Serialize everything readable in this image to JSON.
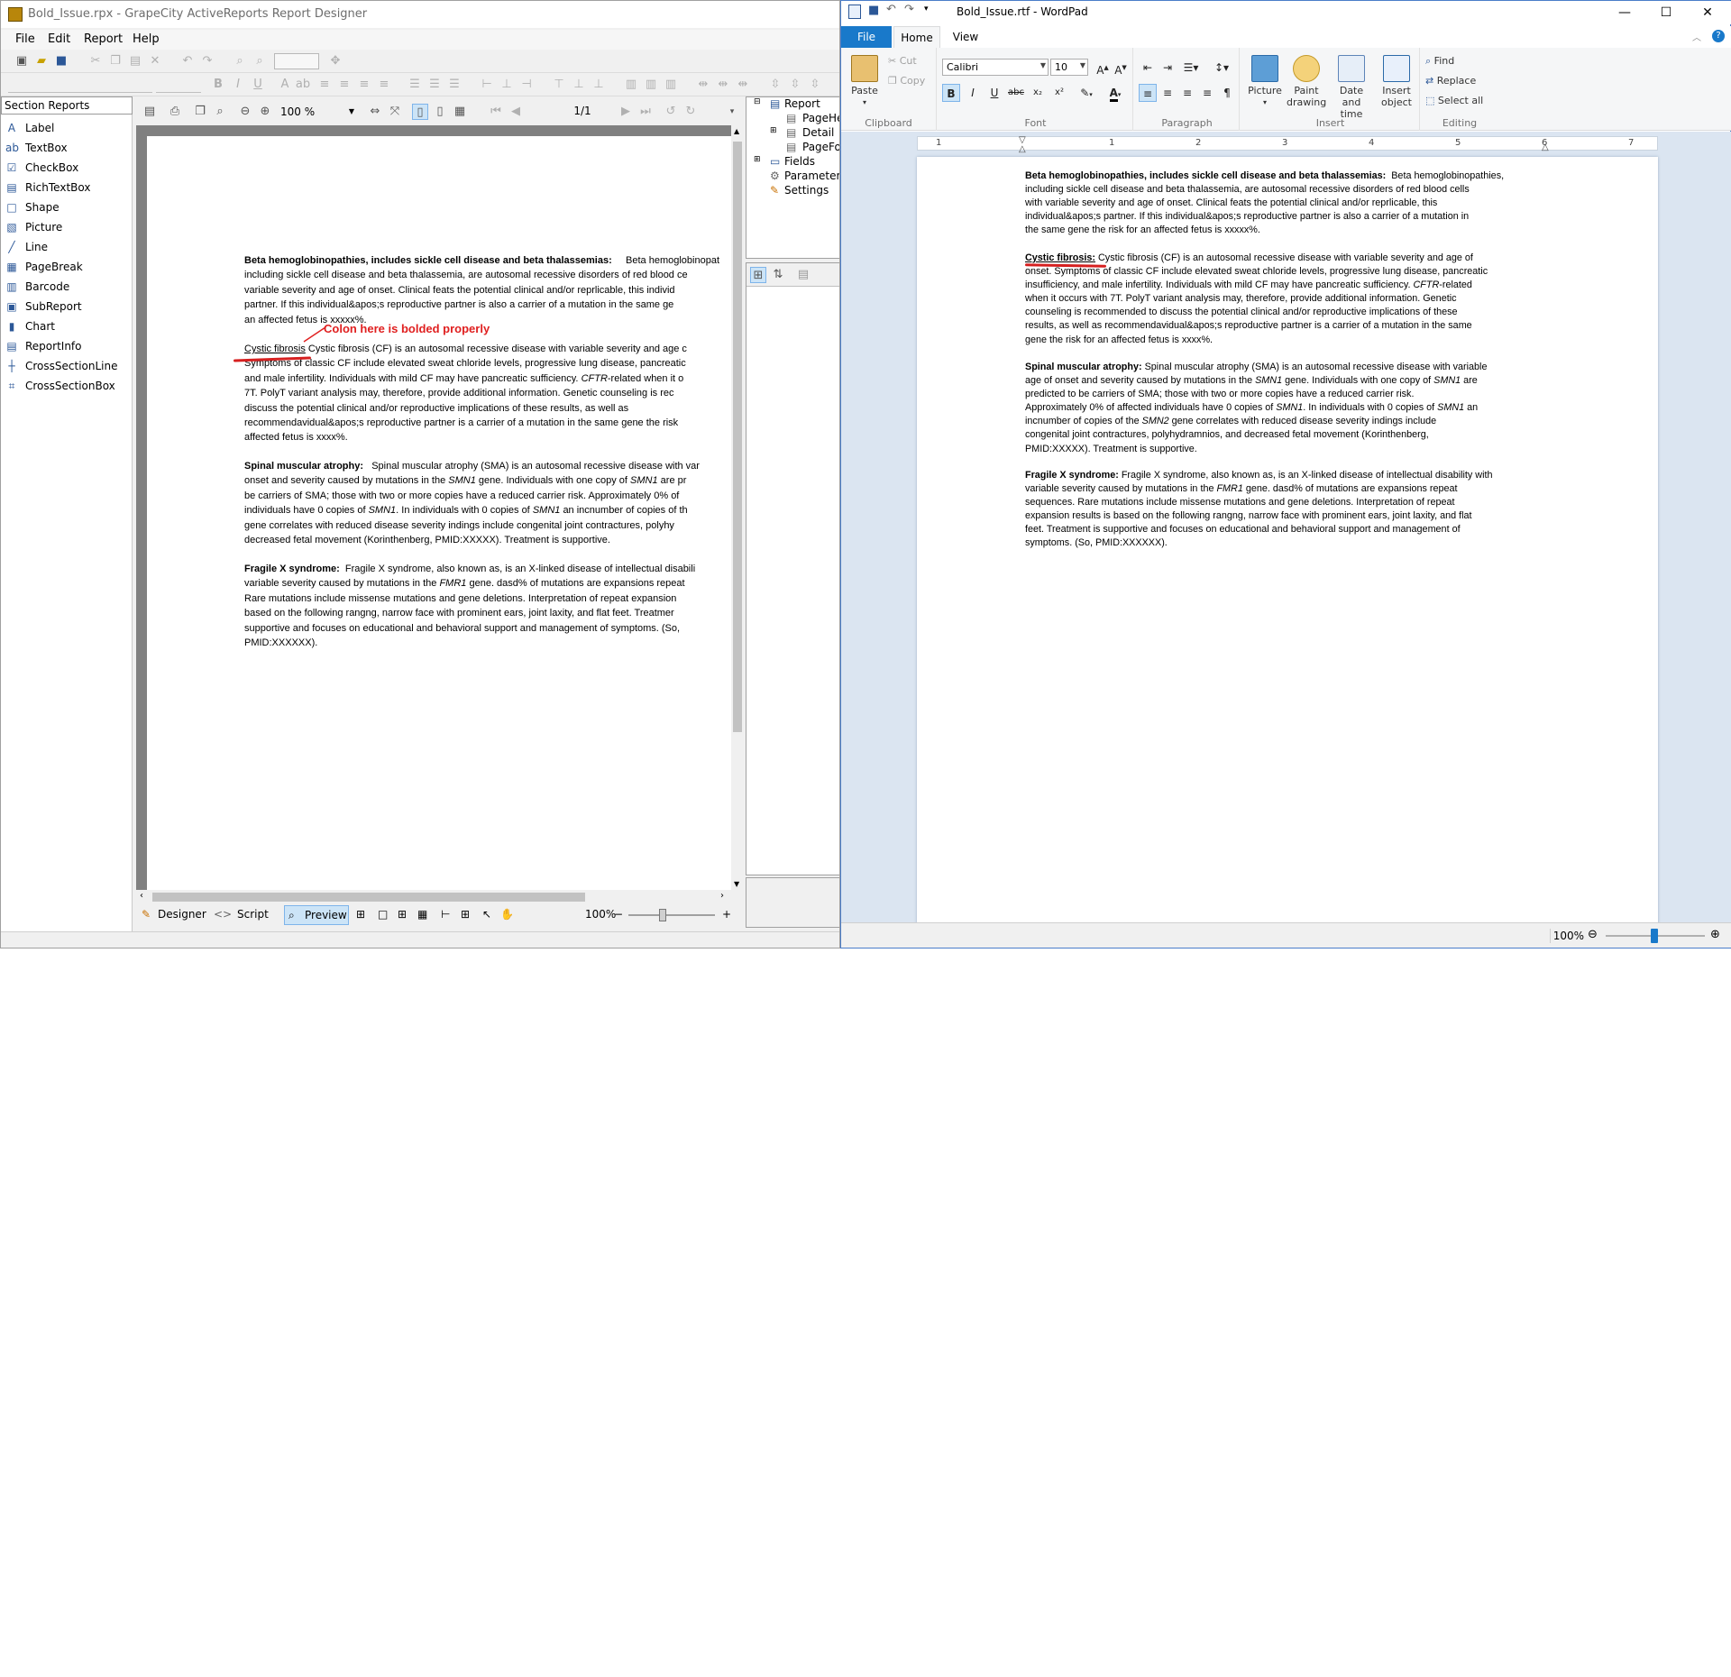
{
  "ar": {
    "title": "Bold_Issue.rpx - GrapeCity ActiveReports Report Designer",
    "menu": [
      "File",
      "Edit",
      "Report",
      "Help"
    ],
    "toolbox": {
      "header": "Section Reports",
      "items": [
        "Label",
        "TextBox",
        "CheckBox",
        "RichTextBox",
        "Shape",
        "Picture",
        "Line",
        "PageBreak",
        "Barcode",
        "SubReport",
        "Chart",
        "ReportInfo",
        "CrossSectionLine",
        "CrossSectionBox"
      ]
    },
    "viewer": {
      "zoom": "100 %",
      "page": "1/1"
    },
    "explorer": [
      "Report",
      "PageHe",
      "Detail",
      "PageFo",
      "Fields",
      "Parameters",
      "Settings"
    ],
    "bottom": {
      "designer": "Designer",
      "script": "Script",
      "preview": "Preview",
      "zoom": "100%"
    },
    "annotation": "Colon here is bolded properly",
    "doc": {
      "p1": {
        "bold": "Beta hemoglobinopathies, includes sickle cell disease and beta thalassemias:",
        "lines": [
          "Beta hemoglobinopat",
          "including sickle cell disease and beta thalassemia, are autosomal recessive disorders of red blood ce",
          "variable severity and age of onset. Clinical feats the potential clinical and/or reprlicable, this individ",
          "partner. If this individual&apos;s reproductive partner is also a carrier of a mutation in the same ge",
          "an affected fetus is xxxxx%."
        ]
      },
      "p2": {
        "underlined": "Cystic fibrosis",
        "lines": [
          "Cystic fibrosis (CF) is an autosomal recessive disease with variable severity and age c",
          "Symptoms of classic CF include elevated sweat chloride levels, progressive lung disease, pancreatic",
          "and male infertility. Individuals with mild CF may have pancreatic sufficiency.",
          "CFTR",
          "-related  when it o",
          "7T. PolyT variant analysis may, therefore, provide additional information. Genetic counseling is rec",
          "discuss the potential clinical and/or reproductive implications of these results, as well as",
          "recommendavidual&apos;s reproductive partner is a carrier of a mutation in the same gene the risk",
          "affected fetus is xxxx%."
        ]
      },
      "p3": {
        "bold": "Spinal muscular atrophy:",
        "lines": [
          "Spinal muscular atrophy (SMA) is an autosomal recessive disease with var",
          "onset and severity caused by mutations in the",
          "SMN1",
          "gene. Individuals with one copy of",
          "SMN1",
          "are pr",
          "be carriers of SMA; those with two or more copies have a reduced carrier risk. Approximately 0% of",
          "individuals have 0 copies of",
          "SMN1",
          ". In individuals with 0 copies of",
          "SMN1",
          "an incnumber of copies of th",
          "gene correlates with reduced disease severity indings  include congenital joint contractures, polyhy",
          "decreased fetal movement (Korinthenberg, PMID:XXXXX). Treatment is supportive."
        ]
      },
      "p4": {
        "bold": "Fragile X syndrome:",
        "lines": [
          "Fragile X syndrome, also known as, is an X-linked disease of intellectual disabili",
          "variable severity caused by mutations in the",
          "FMR1",
          "gene. dasd% of mutations are expansions repeat",
          "Rare mutations include missense mutations and gene deletions. Interpretation of repeat expansion",
          "based on the following rangng, narrow face with prominent ears, joint laxity, and flat feet. Treatmer",
          "supportive and focuses on educational and behavioral support and management of symptoms. (So,",
          "PMID:XXXXXX)."
        ]
      }
    }
  },
  "wp": {
    "title": "Bold_Issue.rtf - WordPad",
    "tabs": [
      "File",
      "Home",
      "View"
    ],
    "clipboard": {
      "label": "Clipboard",
      "paste": "Paste",
      "cut": "Cut",
      "copy": "Copy"
    },
    "font": {
      "label": "Font",
      "family": "Calibri",
      "size": "10"
    },
    "paragraph": {
      "label": "Paragraph"
    },
    "insert": {
      "label": "Insert",
      "picture": "Picture",
      "paint1": "Paint",
      "paint2": "drawing",
      "date1": "Date and",
      "date2": "time",
      "obj1": "Insert",
      "obj2": "object"
    },
    "editing": {
      "label": "Editing",
      "find": "Find",
      "replace": "Replace",
      "selectall": "Select all"
    },
    "ruler": [
      "1",
      "1",
      "2",
      "3",
      "4",
      "5",
      "6",
      "7"
    ],
    "zoom": "100%",
    "doc": {
      "p1": {
        "bold": "Beta hemoglobinopathies,  includes  sickle  cell  disease  and  beta  thalassemias:",
        "lines": [
          "Beta hemoglobinopathies,",
          "including sickle cell disease and beta thalassemia, are autosomal recessive disorders of red blood cells",
          "with variable severity and age of onset. Clinical feats the potential clinical and/or reprlicable, this",
          "individual&apos;s partner. If this individual&apos;s reproductive partner is also a carrier of a mutation in",
          "the same gene  the  risk for an affected fetus is xxxxx%."
        ]
      },
      "p2": {
        "bold": "Cystic  fibrosis:",
        "lines": [
          "Cystic fibrosis (CF) is an autosomal recessive disease with variable severity and age of",
          "onset. Symptoms of classic CF include elevated sweat chloride levels, progressive lung disease, pancreatic",
          "insufficiency, and male infertility. Individuals with mild CF may have pancreatic sufficiency.",
          "CFTR",
          "-related",
          "when  it occurs with 7T. PolyT variant analysis may, therefore, provide additional information. Genetic",
          "counseling is recommended to discuss the potential clinical and/or reproductive implications of these",
          "results, as well as recommendavidual&apos;s reproductive partner is a carrier of a mutation in the same",
          "gene  the  risk for an affected fetus is xxxx%."
        ]
      },
      "p3": {
        "bold": "Spinal  muscular  atrophy:",
        "lines": [
          "Spinal muscular atrophy (SMA) is an autosomal recessive disease with variable",
          "age of onset and severity caused by mutations in the",
          "SMN1",
          "gene.  Individuals with one copy of",
          "SMN1",
          "are",
          "predicted to be carriers of SMA; those with two or more copies have a reduced carrier risk.",
          "Approximately 0% of affected  individuals have 0 copies of",
          "SMN1",
          ". In individuals with 0 copies of",
          "SMN1",
          "an",
          "incnumber of copies of the",
          "SMN2",
          "gene  correlates with reduced disease severity indings  include",
          "congenital joint contractures, polyhydramnios, and decreased fetal movement (Korinthenberg,",
          "PMID:XXXXX).  Treatment  is supportive."
        ]
      },
      "p4": {
        "bold": "Fragile  X  syndrome:",
        "lines": [
          "Fragile X syndrome, also known as, is an X-linked disease of intellectual disability with",
          "variable severity caused by mutations in the",
          "FMR1",
          "gene. dasd% of mutations are expansions repeat",
          "sequences.  Rare mutations include missense mutations and gene deletions. Interpretation of repeat",
          "expansion results is based on the following rangng, narrow face with prominent ears, joint laxity, and flat",
          "feet.  Treatment  is supportive and focuses on educational and behavioral support and management of",
          "symptoms.  (So, PMID:XXXXXX)."
        ]
      }
    }
  },
  "colors": {
    "annotation": "#e02020",
    "fileTab": "#1979ca",
    "docBg": "#dbe5f1"
  }
}
